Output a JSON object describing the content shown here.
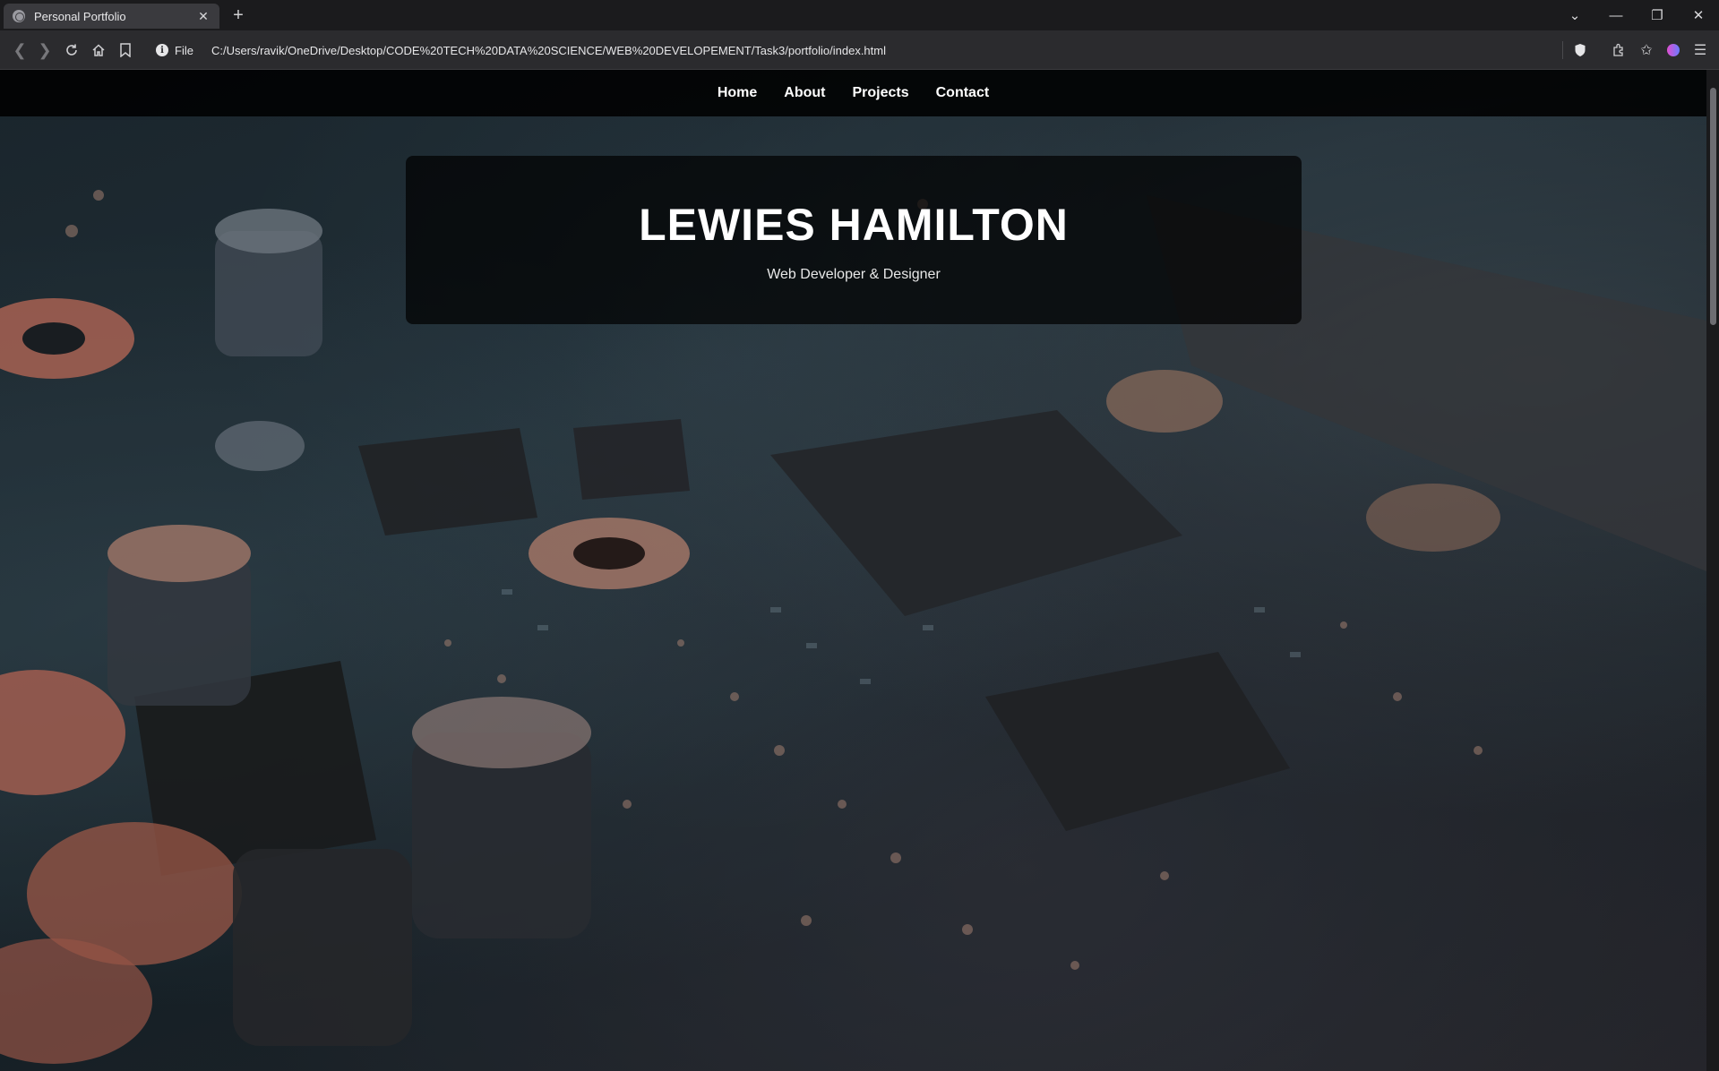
{
  "browser": {
    "tab_title": "Personal Portfolio",
    "new_tab_label": "+",
    "scheme_label": "File",
    "url": "C:/Users/ravik/OneDrive/Desktop/CODE%20TECH%20DATA%20SCIENCE/WEB%20DEVELOPEMENT/Task3/portfolio/index.html",
    "icons": [
      "back-icon",
      "forward-icon",
      "reload-icon",
      "home-icon",
      "bookmark-icon",
      "info-icon",
      "shield-icon",
      "extensions-icon",
      "favorites-icon",
      "profile-icon",
      "menu-icon"
    ]
  },
  "site": {
    "nav": [
      "Home",
      "About",
      "Projects",
      "Contact"
    ],
    "hero": {
      "name": "LEWIES HAMILTON",
      "role": "Web Developer & Designer"
    }
  },
  "colors": {
    "nav_bg": "#000000",
    "hero_bg": "#0a0a0a",
    "text": "#ffffff"
  }
}
